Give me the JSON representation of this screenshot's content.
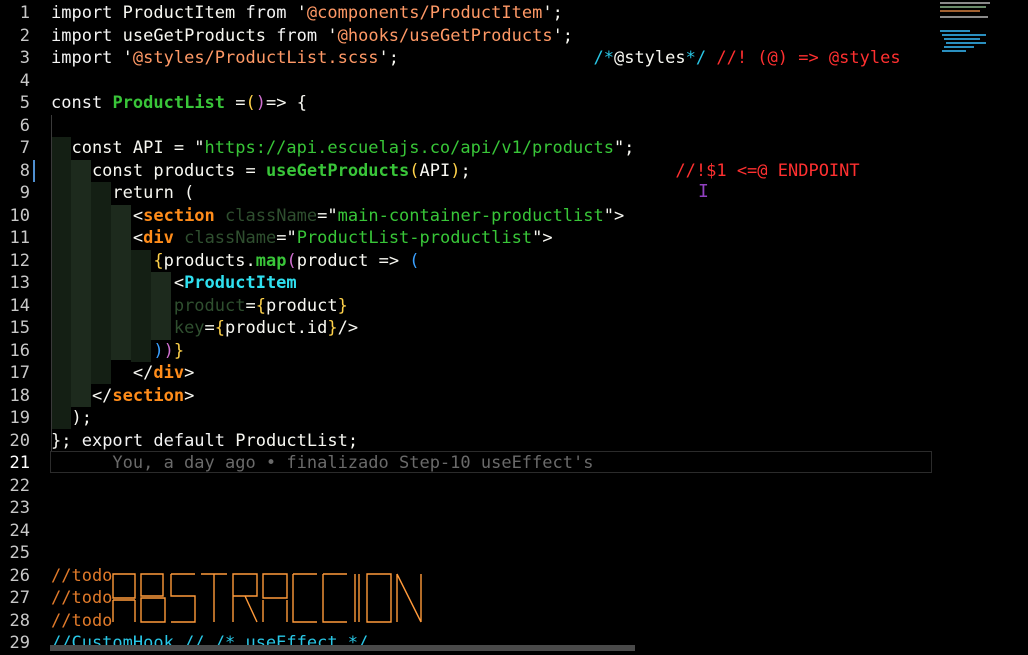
{
  "editor": {
    "lines": [
      {
        "n": "1",
        "segs": [
          [
            "kw",
            "import"
          ],
          [
            "w",
            " ProductItem "
          ],
          [
            "kw",
            "from"
          ],
          [
            "w",
            " '"
          ],
          [
            "path",
            "@components/ProductItem"
          ],
          [
            "w",
            "';"
          ]
        ]
      },
      {
        "n": "2",
        "segs": [
          [
            "kw",
            "import"
          ],
          [
            "w",
            " useGetProducts "
          ],
          [
            "kw",
            "from"
          ],
          [
            "w",
            " '"
          ],
          [
            "path",
            "@hooks/useGetProducts"
          ],
          [
            "w",
            "';"
          ]
        ]
      },
      {
        "n": "3",
        "segs": [
          [
            "kw",
            "import"
          ],
          [
            "w",
            " '"
          ],
          [
            "path",
            "@styles/ProductList.scss"
          ],
          [
            "w",
            "';                   "
          ],
          [
            "cyan",
            "/*"
          ],
          [
            "w",
            "@styles"
          ],
          [
            "cyan",
            "*/ "
          ],
          [
            "red",
            "//! (@) => @styles"
          ]
        ]
      },
      {
        "n": "4",
        "segs": []
      },
      {
        "n": "5",
        "segs": [
          [
            "kw",
            "const"
          ],
          [
            "w",
            " "
          ],
          [
            "fn",
            "ProductList"
          ],
          [
            "w",
            " ="
          ],
          [
            "yl",
            "("
          ],
          [
            "pk",
            ")"
          ],
          [
            "w",
            "=> {"
          ]
        ]
      },
      {
        "n": "6",
        "segs": []
      },
      {
        "n": "7",
        "segs": [
          [
            "w",
            "  const API = \""
          ],
          [
            "strg",
            "https://api.escuelajs.co/api/v1/products"
          ],
          [
            "w",
            "\";"
          ]
        ]
      },
      {
        "n": "8",
        "segs": [
          [
            "w",
            "    const products = "
          ],
          [
            "fn",
            "useGetProducts"
          ],
          [
            "yl",
            "("
          ],
          [
            "w",
            "API"
          ],
          [
            "yl",
            ")"
          ],
          [
            "w",
            ";"
          ],
          [
            "w",
            "                    "
          ],
          [
            "red",
            "//!$1 <=@ ENDPOINT"
          ]
        ]
      },
      {
        "n": "9",
        "segs": [
          [
            "w",
            "      return ("
          ]
        ]
      },
      {
        "n": "10",
        "segs": [
          [
            "w",
            "        <"
          ],
          [
            "tag",
            "section"
          ],
          [
            "w",
            " "
          ],
          [
            "attr",
            "className"
          ],
          [
            "w",
            "=\""
          ],
          [
            "strg",
            "main-container-productlist"
          ],
          [
            "w",
            "\">"
          ]
        ]
      },
      {
        "n": "11",
        "segs": [
          [
            "w",
            "        <"
          ],
          [
            "tag",
            "div"
          ],
          [
            "w",
            " "
          ],
          [
            "attr",
            "className"
          ],
          [
            "w",
            "=\""
          ],
          [
            "strg",
            "ProductList-productlist"
          ],
          [
            "w",
            "\">"
          ]
        ]
      },
      {
        "n": "12",
        "segs": [
          [
            "w",
            "          "
          ],
          [
            "yl",
            "{"
          ],
          [
            "w",
            "products."
          ],
          [
            "fn",
            "map"
          ],
          [
            "pk",
            "("
          ],
          [
            "w",
            "product => "
          ],
          [
            "bl",
            "("
          ]
        ]
      },
      {
        "n": "13",
        "segs": [
          [
            "w",
            "            <"
          ],
          [
            "cmp",
            "ProductItem"
          ]
        ]
      },
      {
        "n": "14",
        "segs": [
          [
            "w",
            "            "
          ],
          [
            "attr",
            "product"
          ],
          [
            "w",
            "="
          ],
          [
            "yl",
            "{"
          ],
          [
            "w",
            "product"
          ],
          [
            "yl",
            "}"
          ]
        ]
      },
      {
        "n": "15",
        "segs": [
          [
            "w",
            "            "
          ],
          [
            "attr",
            "key"
          ],
          [
            "w",
            "="
          ],
          [
            "yl",
            "{"
          ],
          [
            "w",
            "product.id"
          ],
          [
            "yl",
            "}"
          ],
          [
            "w",
            "/>"
          ]
        ]
      },
      {
        "n": "16",
        "segs": [
          [
            "w",
            "          "
          ],
          [
            "bl",
            ")"
          ],
          [
            "pk",
            ")"
          ],
          [
            "yl",
            "}"
          ]
        ]
      },
      {
        "n": "17",
        "segs": [
          [
            "w",
            "        </"
          ],
          [
            "tag",
            "div"
          ],
          [
            "w",
            ">"
          ]
        ]
      },
      {
        "n": "18",
        "segs": [
          [
            "w",
            "    </"
          ],
          [
            "tag",
            "section"
          ],
          [
            "w",
            ">"
          ]
        ]
      },
      {
        "n": "19",
        "segs": [
          [
            "w",
            "  );"
          ]
        ]
      },
      {
        "n": "20",
        "segs": [
          [
            "w",
            "}; "
          ],
          [
            "kw",
            "export default"
          ],
          [
            "w",
            " ProductList;"
          ]
        ]
      },
      {
        "n": "21",
        "segs": [
          [
            "ws-note",
            "      You, a day ago • finalizado Step-10 useEffect's"
          ]
        ]
      },
      {
        "n": "22",
        "segs": []
      },
      {
        "n": "23",
        "segs": []
      },
      {
        "n": "24",
        "segs": []
      },
      {
        "n": "25",
        "segs": []
      },
      {
        "n": "26",
        "segs": [
          [
            "todo",
            "//todo"
          ]
        ]
      },
      {
        "n": "27",
        "segs": [
          [
            "todo",
            "//todo"
          ]
        ]
      },
      {
        "n": "28",
        "segs": [
          [
            "todo",
            "//todo"
          ]
        ]
      },
      {
        "n": "29",
        "segs": [
          [
            "cyan",
            "//CustomHook // /* useEffect */"
          ]
        ]
      }
    ],
    "active_line": "21",
    "ascii_art_word": "ABSTRACCION"
  },
  "colors": {
    "background": "#000000",
    "accent_orange": "#ff8c1a",
    "comment_red": "#ff3030",
    "function_green": "#39c539",
    "component_cyan": "#2fe0f0"
  }
}
